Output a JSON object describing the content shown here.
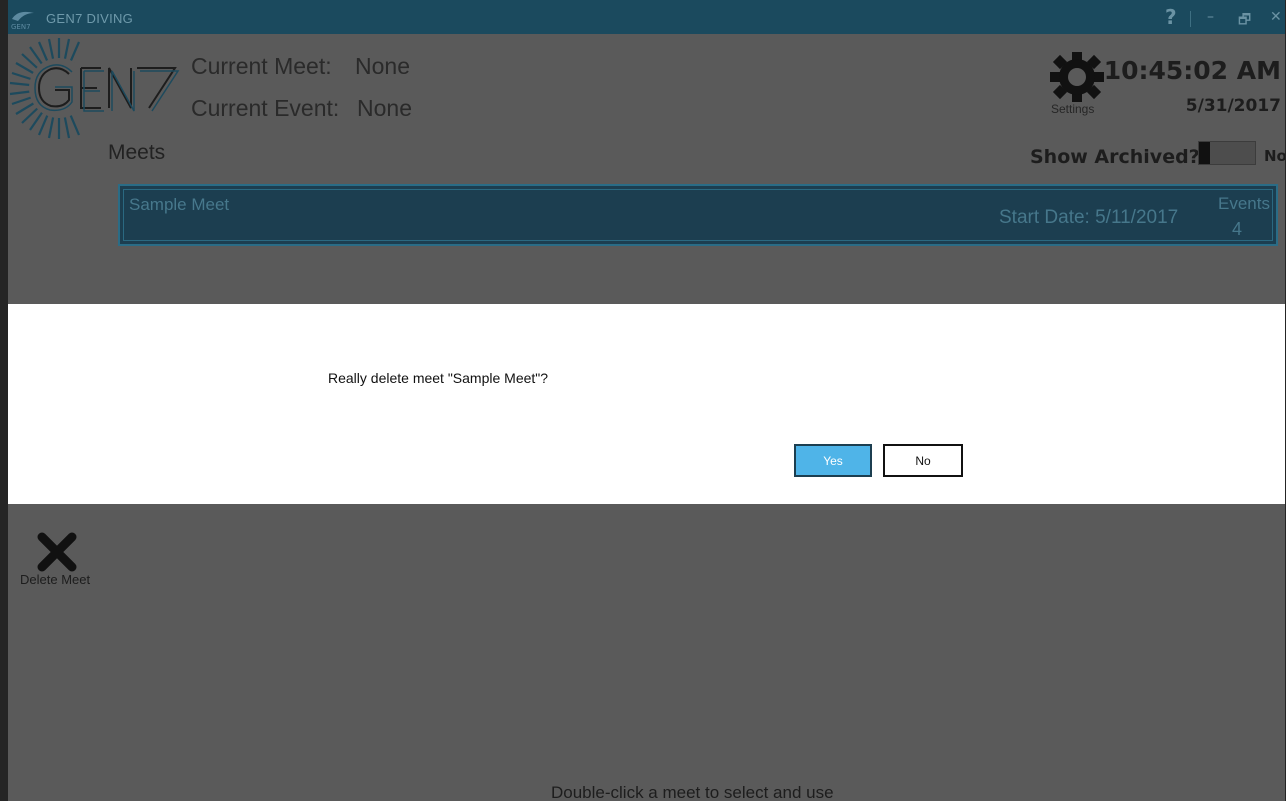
{
  "window": {
    "title": "GEN7 DIVING",
    "help_icon": "?",
    "minimize_icon": "–",
    "restore_icon": "🗗",
    "close_icon": "✕"
  },
  "header": {
    "current_meet_label": "Current Meet:",
    "current_meet_value": "None",
    "current_event_label": "Current Event:",
    "current_event_value": "None",
    "settings_label": "Settings",
    "time": "10:45:02 AM",
    "date": "5/31/2017"
  },
  "meets": {
    "title": "Meets",
    "show_archived_label": "Show Archived?",
    "show_archived_value": "No",
    "items": [
      {
        "name": "Sample Meet",
        "start_date": "Start Date: 5/11/2017",
        "events_label": "Events",
        "events_count": "4"
      }
    ]
  },
  "dialog": {
    "message": "Really delete meet \"Sample Meet\"?",
    "yes_label": "Yes",
    "no_label": "No"
  },
  "toolbar": {
    "delete_label": "Delete Meet"
  },
  "footer": {
    "hint": "Double-click a meet to select and use"
  },
  "colors": {
    "titlebar": "#1b4a5e",
    "background": "#5a5a5a",
    "meet_row": "#1c3e50",
    "accent_button": "#4fb4e8",
    "dialog": "#ffffff"
  }
}
